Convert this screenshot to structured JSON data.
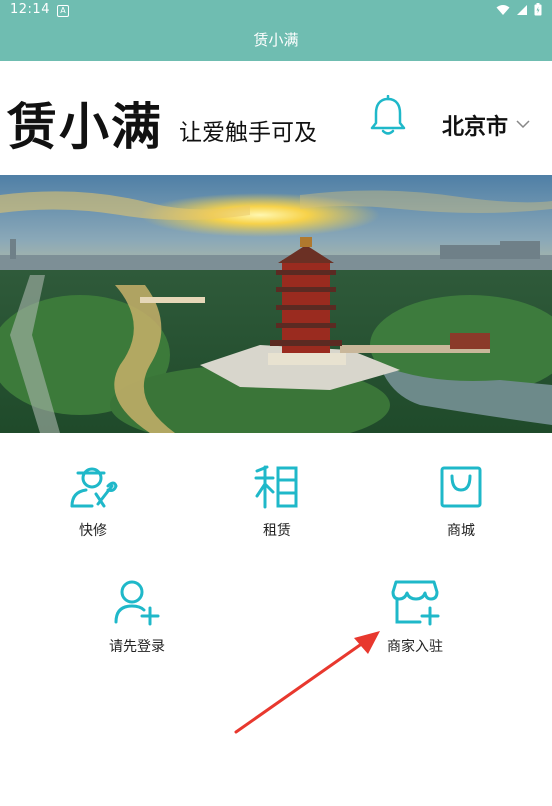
{
  "status_bar": {
    "time": "12:14",
    "app_badge": "A"
  },
  "title_bar": {
    "title": "赁小满"
  },
  "header": {
    "brand": "赁小满",
    "slogan": "让爱触手可及",
    "city": "北京市"
  },
  "icons": {
    "bell": "bell-icon",
    "chevron": "chevron-down-icon",
    "wifi": "wifi-icon",
    "signal": "signal-icon",
    "battery": "battery-icon"
  },
  "banner": {
    "slides": 3,
    "active_slide": 1
  },
  "grid": [
    {
      "label": "快修",
      "icon": "repair-icon"
    },
    {
      "label": "租赁",
      "icon": "rent-icon"
    },
    {
      "label": "商城",
      "icon": "shop-bag-icon"
    },
    {
      "label": "请先登录",
      "icon": "add-user-icon"
    },
    {
      "label": "商家入驻",
      "icon": "merchant-store-icon"
    }
  ],
  "colors": {
    "primary": "#6fbdb1",
    "accent_icon": "#1fb8c9",
    "annotation_arrow": "#e8382e"
  }
}
